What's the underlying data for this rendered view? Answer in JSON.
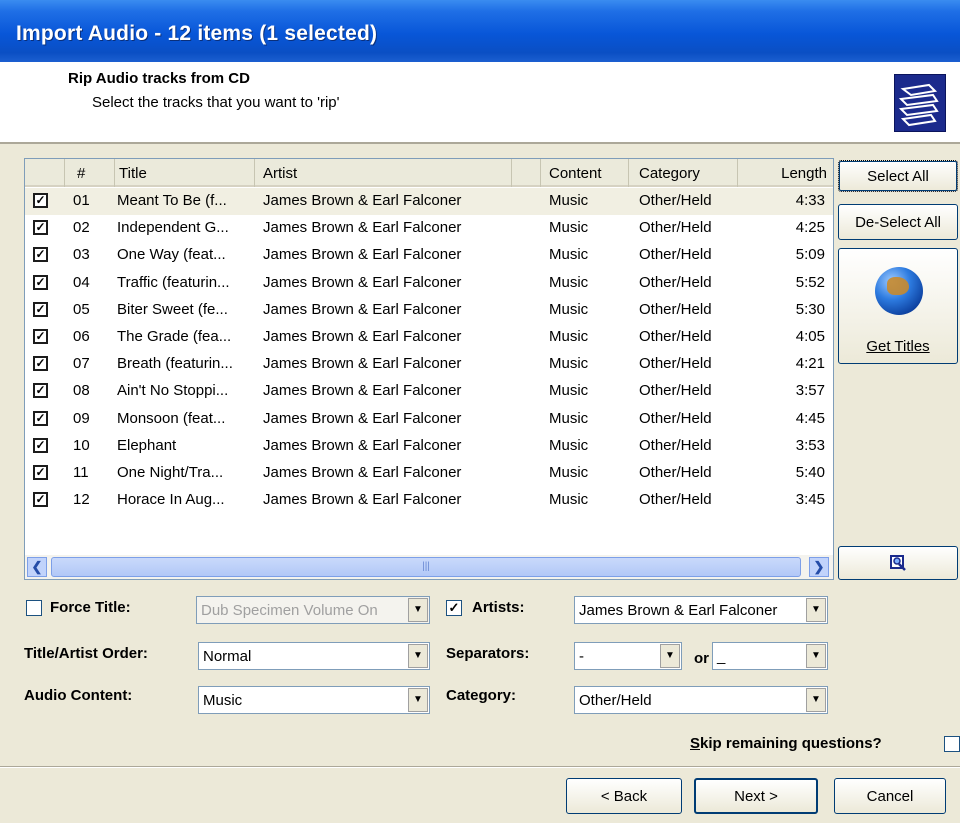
{
  "window": {
    "title": "Import Audio - 12 items (1 selected)"
  },
  "header": {
    "title": "Rip Audio tracks from CD",
    "subtitle": "Select the tracks that you want to 'rip'",
    "icon": "document-stack-icon"
  },
  "table": {
    "columns": {
      "num": "#",
      "title": "Title",
      "artist": "Artist",
      "content": "Content",
      "category": "Category",
      "length": "Length"
    },
    "rows": [
      {
        "num": "01",
        "title": "Meant To Be (f...",
        "artist": "James Brown & Earl Falconer",
        "content": "Music",
        "category": "Other/Held",
        "length": "4:33",
        "checked": true,
        "selected": true
      },
      {
        "num": "02",
        "title": "Independent G...",
        "artist": "James Brown & Earl Falconer",
        "content": "Music",
        "category": "Other/Held",
        "length": "4:25",
        "checked": true
      },
      {
        "num": "03",
        "title": "One Way (feat...",
        "artist": "James Brown & Earl Falconer",
        "content": "Music",
        "category": "Other/Held",
        "length": "5:09",
        "checked": true
      },
      {
        "num": "04",
        "title": "Traffic (featurin...",
        "artist": "James Brown & Earl Falconer",
        "content": "Music",
        "category": "Other/Held",
        "length": "5:52",
        "checked": true
      },
      {
        "num": "05",
        "title": "Biter Sweet (fe...",
        "artist": "James Brown & Earl Falconer",
        "content": "Music",
        "category": "Other/Held",
        "length": "5:30",
        "checked": true
      },
      {
        "num": "06",
        "title": "The Grade (fea...",
        "artist": "James Brown & Earl Falconer",
        "content": "Music",
        "category": "Other/Held",
        "length": "4:05",
        "checked": true
      },
      {
        "num": "07",
        "title": "Breath (featurin...",
        "artist": "James Brown & Earl Falconer",
        "content": "Music",
        "category": "Other/Held",
        "length": "4:21",
        "checked": true
      },
      {
        "num": "08",
        "title": "Ain't No Stoppi...",
        "artist": "James Brown & Earl Falconer",
        "content": "Music",
        "category": "Other/Held",
        "length": "3:57",
        "checked": true
      },
      {
        "num": "09",
        "title": "Monsoon (feat...",
        "artist": "James Brown & Earl Falconer",
        "content": "Music",
        "category": "Other/Held",
        "length": "4:45",
        "checked": true
      },
      {
        "num": "10",
        "title": "Elephant",
        "artist": "James Brown & Earl Falconer",
        "content": "Music",
        "category": "Other/Held",
        "length": "3:53",
        "checked": true
      },
      {
        "num": "11",
        "title": "One Night/Tra...",
        "artist": "James Brown & Earl Falconer",
        "content": "Music",
        "category": "Other/Held",
        "length": "5:40",
        "checked": true
      },
      {
        "num": "12",
        "title": "Horace In Aug...",
        "artist": "James Brown & Earl Falconer",
        "content": "Music",
        "category": "Other/Held",
        "length": "3:45",
        "checked": true
      }
    ]
  },
  "side": {
    "select_all": "Select All",
    "deselect_all": "De-Select All",
    "get_titles": "Get Titles",
    "get_titles_icon": "globe-icon",
    "search_icon": "magnifier-icon"
  },
  "form": {
    "force_title_label": "Force Title:",
    "force_title_checked": false,
    "force_title_value": "Dub Specimen Volume On",
    "artists_label": "Artists:",
    "artists_checked": true,
    "artists_value": "James Brown & Earl Falconer",
    "order_label": "Title/Artist Order:",
    "order_value": "Normal",
    "separators_label": "Separators:",
    "separator1_value": "-",
    "or_label": "or",
    "separator2_value": "_",
    "content_label": "Audio Content:",
    "content_value": "Music",
    "category_label": "Category:",
    "category_value": "Other/Held",
    "skip_label": "Skip remaining questions?",
    "skip_checked": false
  },
  "footer": {
    "back": "< Back",
    "next": "Next >",
    "cancel": "Cancel"
  }
}
